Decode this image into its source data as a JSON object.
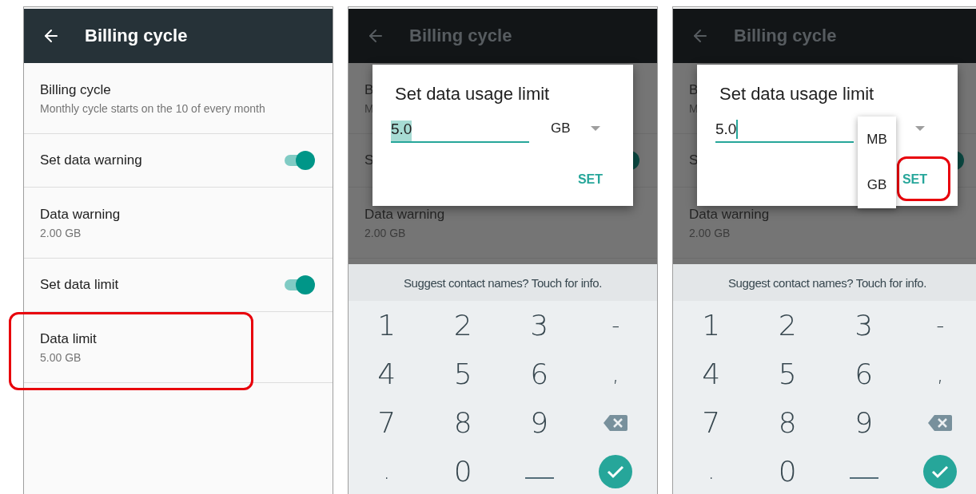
{
  "panels": [
    {
      "kind": "settings",
      "title": "Billing cycle",
      "items": [
        {
          "kind": "text",
          "title": "Billing cycle",
          "subtitle": "Monthly cycle starts on the 10 of every month",
          "highlighted": false
        },
        {
          "kind": "toggle",
          "title": "Set data warning",
          "on": true
        },
        {
          "kind": "text",
          "title": "Data warning",
          "subtitle": "2.00 GB",
          "highlighted": false
        },
        {
          "kind": "toggle",
          "title": "Set data limit",
          "on": true
        },
        {
          "kind": "text",
          "title": "Data limit",
          "subtitle": "5.00 GB",
          "highlighted": true
        }
      ]
    },
    {
      "kind": "dialog",
      "title": "Billing cycle",
      "background": [
        {
          "kind": "text",
          "title": "B",
          "subtitle": "M"
        },
        {
          "kind": "toggle",
          "title": "S",
          "on": true
        },
        {
          "kind": "text",
          "title": "Data warning",
          "subtitle": "2.00 GB"
        }
      ],
      "dialog": {
        "title": "Set data usage limit",
        "value": "5.0",
        "value_selected": true,
        "unit": "GB",
        "button": "SET",
        "button_highlighted": false
      },
      "keyboard": {
        "suggestion": "Suggest contact names? Touch for info.",
        "keys": [
          {
            "kind": "char",
            "label": "1"
          },
          {
            "kind": "char",
            "label": "2"
          },
          {
            "kind": "char",
            "label": "3"
          },
          {
            "kind": "char",
            "label": "-"
          },
          {
            "kind": "char",
            "label": "4"
          },
          {
            "kind": "char",
            "label": "5"
          },
          {
            "kind": "char",
            "label": "6"
          },
          {
            "kind": "char",
            "label": ","
          },
          {
            "kind": "char",
            "label": "7"
          },
          {
            "kind": "char",
            "label": "8"
          },
          {
            "kind": "char",
            "label": "9"
          },
          {
            "kind": "backspace"
          },
          {
            "kind": "char",
            "label": "."
          },
          {
            "kind": "char",
            "label": "0"
          },
          {
            "kind": "space"
          },
          {
            "kind": "done"
          }
        ]
      }
    },
    {
      "kind": "dialog",
      "title": "Billing cycle",
      "background": [
        {
          "kind": "text",
          "title": "B",
          "subtitle": "M"
        },
        {
          "kind": "toggle",
          "title": "S",
          "on": true
        },
        {
          "kind": "text",
          "title": "Data warning",
          "subtitle": "2.00 GB"
        }
      ],
      "dialog": {
        "title": "Set data usage limit",
        "value": "5.0",
        "value_selected": false,
        "unit_menu": [
          "MB",
          "GB"
        ],
        "button": "SET",
        "button_highlighted": true
      },
      "keyboard": {
        "suggestion": "Suggest contact names? Touch for info.",
        "keys": [
          {
            "kind": "char",
            "label": "1"
          },
          {
            "kind": "char",
            "label": "2"
          },
          {
            "kind": "char",
            "label": "3"
          },
          {
            "kind": "char",
            "label": "-"
          },
          {
            "kind": "char",
            "label": "4"
          },
          {
            "kind": "char",
            "label": "5"
          },
          {
            "kind": "char",
            "label": "6"
          },
          {
            "kind": "char",
            "label": ","
          },
          {
            "kind": "char",
            "label": "7"
          },
          {
            "kind": "char",
            "label": "8"
          },
          {
            "kind": "char",
            "label": "9"
          },
          {
            "kind": "backspace"
          },
          {
            "kind": "char",
            "label": "."
          },
          {
            "kind": "char",
            "label": "0"
          },
          {
            "kind": "space"
          },
          {
            "kind": "done"
          }
        ]
      }
    }
  ]
}
